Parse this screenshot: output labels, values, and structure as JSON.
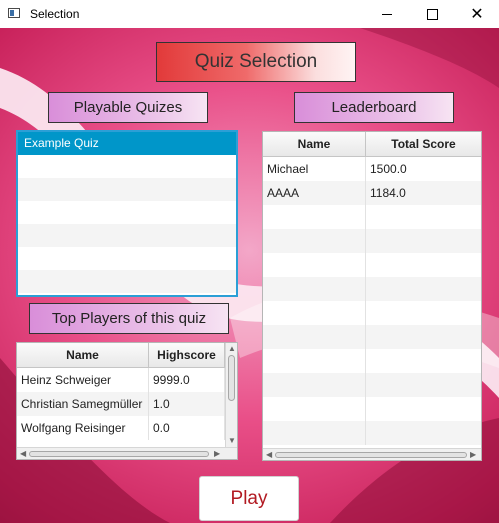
{
  "window": {
    "title": "Selection",
    "minimize_glyph": "minimize-icon",
    "maximize_glyph": "maximize-icon",
    "close_glyph": "✕"
  },
  "header": {
    "title": "Quiz Selection"
  },
  "playable": {
    "label": "Playable Quizes",
    "items": [
      "Example Quiz"
    ],
    "selected": "Example Quiz"
  },
  "leaderboard": {
    "label": "Leaderboard",
    "columns": [
      "Name",
      "Total Score"
    ],
    "rows": [
      [
        "Michael",
        "1500.0"
      ],
      [
        "AAAA",
        "1184.0"
      ]
    ]
  },
  "top_players": {
    "label": "Top Players of this quiz",
    "columns": [
      "Name",
      "Highscore"
    ],
    "rows": [
      [
        "Heinz Schweiger",
        "9999.0"
      ],
      [
        "Christian Samegmüller",
        "1.0"
      ],
      [
        "Wolfgang Reisinger",
        "0.0"
      ]
    ]
  },
  "actions": {
    "play_label": "Play"
  },
  "colors": {
    "selection_blue": "#0096c9",
    "title_red": "#e23a3a",
    "header_pink": "#d98ed9",
    "play_text": "#b21a22"
  }
}
